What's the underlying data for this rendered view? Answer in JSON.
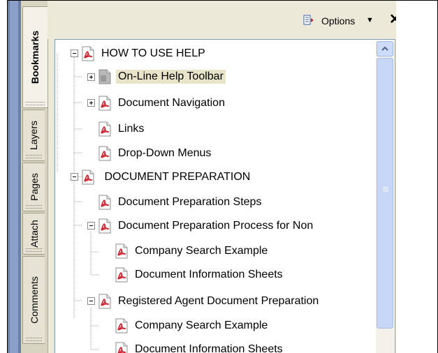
{
  "panel": {
    "side_tabs": [
      {
        "label": "Bookmarks",
        "active": true
      },
      {
        "label": "Layers",
        "active": false
      },
      {
        "label": "Pages",
        "active": false
      },
      {
        "label": "Attach",
        "active": false
      },
      {
        "label": "Comments",
        "active": false
      }
    ],
    "toolbar": {
      "options_label": "Options",
      "options_icon": "options-menu-icon",
      "caret_glyph": "▼",
      "close_glyph": "✕"
    },
    "bookmarks": [
      {
        "label": "HOW TO USE HELP",
        "icon": "pdf-bookmark-icon",
        "expander": "minus",
        "level": 0
      },
      {
        "label": "On-Line Help Toolbar",
        "icon": "gray-page-bookmark-icon",
        "expander": "plus",
        "level": 1,
        "selected": true
      },
      {
        "label": "Document Navigation",
        "icon": "pdf-bookmark-icon",
        "expander": "plus",
        "level": 1
      },
      {
        "label": "Links",
        "icon": "pdf-bookmark-icon",
        "expander": "none",
        "level": 1
      },
      {
        "label": "Drop-Down Menus",
        "icon": "pdf-bookmark-icon",
        "expander": "none",
        "level": 1
      },
      {
        "label": " DOCUMENT PREPARATION",
        "icon": "pdf-bookmark-icon",
        "expander": "minus",
        "level": 0
      },
      {
        "label": "Document Preparation Steps",
        "icon": "pdf-bookmark-icon",
        "expander": "none",
        "level": 1
      },
      {
        "label": "Document Preparation Process for Non",
        "icon": "pdf-bookmark-icon",
        "expander": "minus",
        "level": 1
      },
      {
        "label": "Company Search Example",
        "icon": "pdf-bookmark-icon",
        "expander": "none",
        "level": 2
      },
      {
        "label": "Document Information Sheets",
        "icon": "pdf-bookmark-icon",
        "expander": "none",
        "level": 2
      },
      {
        "label": "Registered Agent Document Preparation",
        "icon": "pdf-bookmark-icon",
        "expander": "minus",
        "level": 1
      },
      {
        "label": "Company Search Example",
        "icon": "pdf-bookmark-icon",
        "expander": "none",
        "level": 2
      },
      {
        "label": "Document Information Sheets",
        "icon": "pdf-bookmark-icon",
        "expander": "none",
        "level": 2
      }
    ],
    "colors": {
      "panel_bg": "#ece9d8",
      "pdf_red": "#d21d2a",
      "selected_bg": "#e8e4c9",
      "scroll_blue": "#c7d6f6"
    }
  }
}
